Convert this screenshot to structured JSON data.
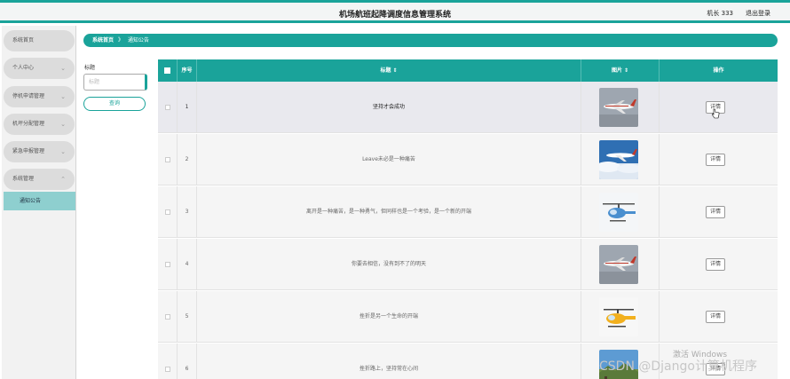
{
  "header": {
    "title": "机场航班起降调度信息管理系统",
    "user": "机长 333",
    "logout": "退出登录"
  },
  "sidebar": {
    "items": [
      {
        "label": "系统首页",
        "has_chevron": false
      },
      {
        "label": "个人中心",
        "has_chevron": true
      },
      {
        "label": "停机申请管理",
        "has_chevron": true
      },
      {
        "label": "机坪分配管理",
        "has_chevron": true
      },
      {
        "label": "紧急申报管理",
        "has_chevron": true
      },
      {
        "label": "系统管理",
        "has_chevron": true,
        "expanded": true
      }
    ],
    "sub_item": "通知公告"
  },
  "breadcrumb": {
    "home": "系统首页",
    "separator": "》",
    "current": "通知公告"
  },
  "filter": {
    "label": "标题",
    "placeholder": "标题",
    "query_button": "查询"
  },
  "table": {
    "columns": {
      "index": "序号",
      "title": "标题 ⇕",
      "image": "图片 ⇕",
      "action": "操作"
    },
    "rows": [
      {
        "index": "1",
        "title": "坚持才会成功",
        "image_icon": "airliner-image",
        "action": "详情"
      },
      {
        "index": "2",
        "title": "Leave未必是一种痛苦",
        "image_icon": "airliner-sky-image",
        "action": "详情"
      },
      {
        "index": "3",
        "title": "离开是一种痛苦，是一种勇气，但同样也是一个考验，是一个新的开端",
        "image_icon": "helicopter-image",
        "action": "详情"
      },
      {
        "index": "4",
        "title": "你要去相信，没有到不了的明天",
        "image_icon": "airliner-image",
        "action": "详情"
      },
      {
        "index": "5",
        "title": "挫折是另一个生命的开端",
        "image_icon": "yellow-helicopter-image",
        "action": "详情"
      },
      {
        "index": "6",
        "title": "挫折路上，坚持常在心间",
        "image_icon": "landscape-image",
        "action": "详情"
      }
    ]
  },
  "watermarks": {
    "windows": "激活 Windows",
    "csdn": "CSDN @Django计算机程序"
  },
  "colors": {
    "accent": "#1aa39a",
    "sidebar_active": "#8ecfcf"
  }
}
